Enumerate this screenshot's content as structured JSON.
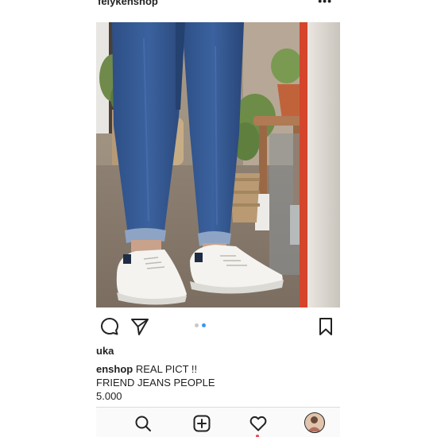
{
  "post": {
    "username": "felykenshop",
    "more_icon": "more-dots-icon",
    "photo_subject": "post-photo"
  },
  "actions": {
    "icons": [
      "comment-icon",
      "share-icon",
      "bookmark-icon"
    ],
    "carousel": {
      "count": 2,
      "active": 2,
      "active_color": "#3897f0",
      "inactive_color": "#c8c8c8"
    }
  },
  "likes_line": "uka",
  "caption": {
    "user": "enshop",
    "text": " REAL PICT !!",
    "line2": "FRIEND JEANS PEOPLE",
    "line3": "5.000"
  },
  "tabbar": {
    "icons": [
      "search-icon",
      "new-post-icon",
      "activity-heart-icon",
      "profile-avatar"
    ],
    "notification_color": "#ed4956"
  }
}
